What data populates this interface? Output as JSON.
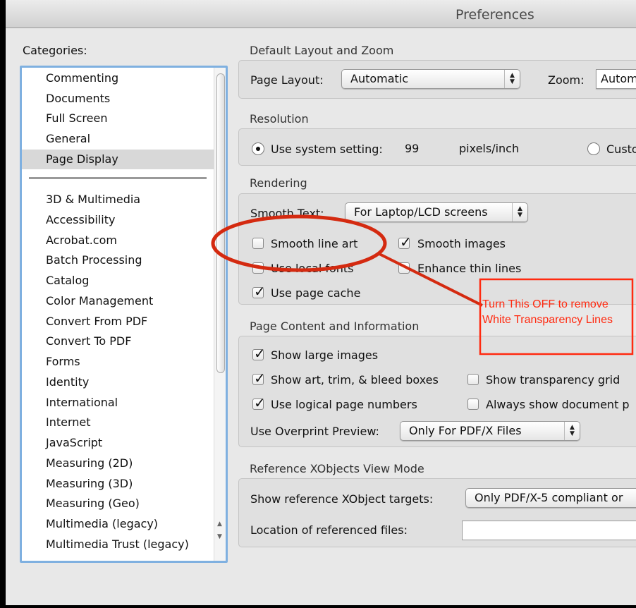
{
  "window": {
    "title": "Preferences"
  },
  "sidebar": {
    "label": "Categories:",
    "items_top": [
      "Commenting",
      "Documents",
      "Full Screen",
      "General",
      "Page Display"
    ],
    "selected": "Page Display",
    "items": [
      "3D & Multimedia",
      "Accessibility",
      "Acrobat.com",
      "Batch Processing",
      "Catalog",
      "Color Management",
      "Convert From PDF",
      "Convert To PDF",
      "Forms",
      "Identity",
      "International",
      "Internet",
      "JavaScript",
      "Measuring (2D)",
      "Measuring (3D)",
      "Measuring (Geo)",
      "Multimedia (legacy)",
      "Multimedia Trust (legacy)"
    ]
  },
  "layout": {
    "section": "Default Layout and Zoom",
    "page_layout_label": "Page Layout:",
    "page_layout_value": "Automatic",
    "zoom_label": "Zoom:",
    "zoom_value": "Autom"
  },
  "resolution": {
    "section": "Resolution",
    "system_label": "Use system setting:",
    "system_value": "99",
    "unit": "pixels/inch",
    "custom_label": "Custo",
    "selected": "system"
  },
  "rendering": {
    "section": "Rendering",
    "smooth_text_label": "Smooth Text:",
    "smooth_text_value": "For Laptop/LCD screens",
    "smooth_line_art": {
      "label": "Smooth line art",
      "checked": false
    },
    "smooth_images": {
      "label": "Smooth images",
      "checked": true
    },
    "use_local_fonts": {
      "label": "Use local fonts",
      "checked": false
    },
    "enhance_thin_lines": {
      "label": "Enhance thin lines",
      "checked": false
    },
    "use_page_cache": {
      "label": "Use page cache",
      "checked": true
    }
  },
  "page_content": {
    "section": "Page Content and Information",
    "show_large_images": {
      "label": "Show large images",
      "checked": true
    },
    "show_boxes": {
      "label": "Show art, trim, & bleed boxes",
      "checked": true
    },
    "show_grid": {
      "label": "Show transparency grid",
      "checked": false
    },
    "logical_numbers": {
      "label": "Use logical page numbers",
      "checked": true
    },
    "always_show": {
      "label": "Always show document p",
      "checked": false
    },
    "overprint_label": "Use Overprint Preview:",
    "overprint_value": "Only For PDF/X Files"
  },
  "xobjects": {
    "section": "Reference XObjects View Mode",
    "targets_label": "Show reference XObject targets:",
    "targets_value": "Only PDF/X-5 compliant or",
    "location_label": "Location of referenced files:",
    "location_value": ""
  },
  "annotation": {
    "line1": "Turn This OFF to remove",
    "line2": "White Transparency Lines",
    "color": "#ff2a10"
  }
}
